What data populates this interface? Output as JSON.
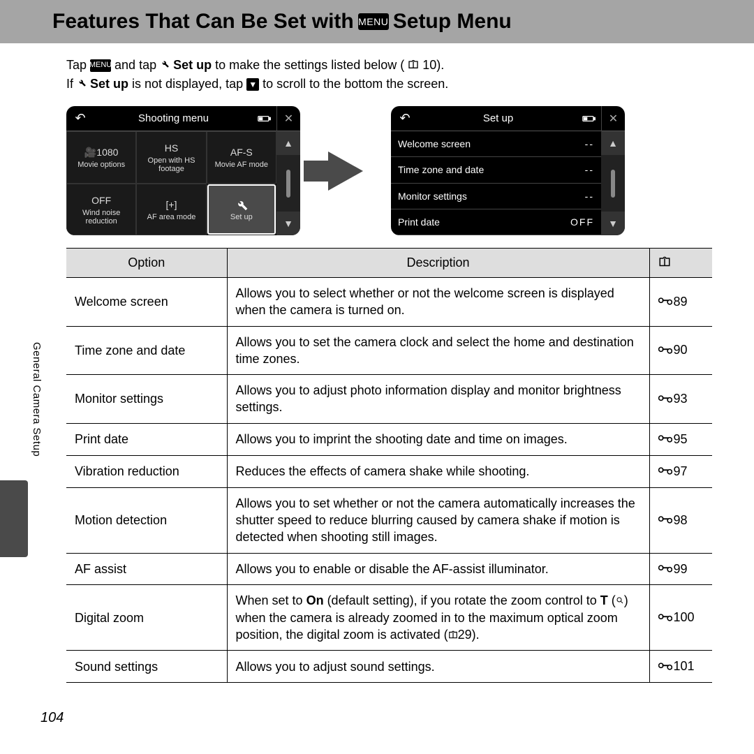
{
  "title_pre": "Features That Can Be Set with ",
  "title_post": " Setup Menu",
  "menu_label": "MENU",
  "intro": {
    "l1a": "Tap ",
    "l1b": " and tap ",
    "l1c": " Set up",
    "l1d": " to make the settings listed below (",
    "l1e": "10).",
    "l2a": "If ",
    "l2b": " Set up",
    "l2c": " is not displayed, tap ",
    "l2d": " to scroll to the bottom the screen."
  },
  "lcd1": {
    "title": "Shooting menu",
    "cells": [
      {
        "icon": "🎥1080",
        "label": "Movie options"
      },
      {
        "icon": "HS",
        "label": "Open with HS footage"
      },
      {
        "icon": "AF-S",
        "label": "Movie AF mode"
      },
      {
        "icon": "OFF",
        "label": "Wind noise reduction"
      },
      {
        "icon": "[+]",
        "label": "AF area mode"
      },
      {
        "icon": "wrench",
        "label": "Set up"
      }
    ]
  },
  "lcd2": {
    "title": "Set up",
    "rows": [
      {
        "label": "Welcome screen",
        "val": "--"
      },
      {
        "label": "Time zone and date",
        "val": "--"
      },
      {
        "label": "Monitor settings",
        "val": "--"
      },
      {
        "label": "Print date",
        "val": "OFF"
      }
    ]
  },
  "table": {
    "h1": "Option",
    "h2": "Description",
    "rows": [
      {
        "opt": "Welcome screen",
        "desc": "Allows you to select whether or not the welcome screen is displayed when the camera is turned on.",
        "ref": "89"
      },
      {
        "opt": "Time zone and date",
        "desc": "Allows you to set the camera clock and select the home and destination time zones.",
        "ref": "90"
      },
      {
        "opt": "Monitor settings",
        "desc": "Allows you to adjust photo information display and monitor brightness settings.",
        "ref": "93"
      },
      {
        "opt": "Print date",
        "desc": "Allows you to imprint the shooting date and time on images.",
        "ref": "95"
      },
      {
        "opt": "Vibration reduction",
        "desc": "Reduces the effects of camera shake while shooting.",
        "ref": "97"
      },
      {
        "opt": "Motion detection",
        "desc": "Allows you to set whether or not the camera automatically increases the shutter speed to reduce blurring caused by camera shake if motion is detected when shooting still images.",
        "ref": "98"
      },
      {
        "opt": "AF assist",
        "desc": "Allows you to enable or disable the AF-assist illuminator.",
        "ref": "99"
      },
      {
        "opt": "Digital zoom",
        "desc_html": "When set to <b>On</b> (default setting), if you rotate the zoom control to <b>T</b> (<svg width='12' height='12' viewBox='0 0 24 24' fill='none' stroke='currentColor' stroke-width='2'><circle cx='10' cy='10' r='6'/><line x1='15' y1='15' x2='20' y2='20'/></svg>) when the camera is already zoomed in to the maximum optical zoom position, the digital zoom is activated (<svg width='14' height='12' viewBox='0 0 24 20' fill='none' stroke='currentColor' stroke-width='2'><path d='M3 18V4h6l2-2h2l2 2h6v14z'/><path d='M12 4v14'/></svg>29).",
        "ref": "100"
      },
      {
        "opt": "Sound settings",
        "desc": "Allows you to adjust sound settings.",
        "ref": "101"
      }
    ]
  },
  "side_label": "General Camera Setup",
  "page_num": "104"
}
